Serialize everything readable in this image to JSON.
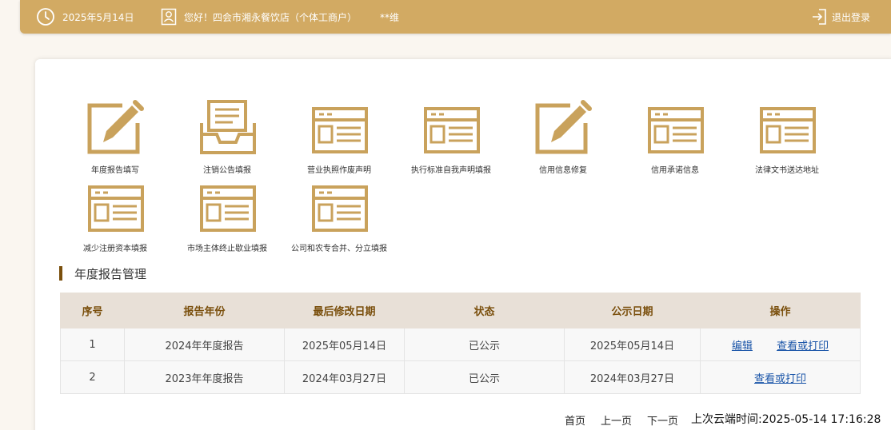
{
  "header": {
    "date": "2025年5月14日",
    "greeting": "您好！四会市湘永餐饮店（个体工商户）",
    "user": "**维",
    "logout_label": "退出登录"
  },
  "colors": {
    "gold": "#d2aa63",
    "icon_gold": "#c9a25c",
    "accent_brown": "#7a4f0c",
    "link_blue": "#1a55a8"
  },
  "tiles": [
    {
      "label": "年度报告填写",
      "icon": "edit-pen-icon"
    },
    {
      "label": "注销公告填报",
      "icon": "inbox-tray-icon"
    },
    {
      "label": "营业执照作废声明",
      "icon": "form-card-icon"
    },
    {
      "label": "执行标准自我声明填报",
      "icon": "form-card-icon"
    },
    {
      "label": "信用信息修复",
      "icon": "edit-pen-icon"
    },
    {
      "label": "信用承诺信息",
      "icon": "form-card-icon"
    },
    {
      "label": "法律文书送达地址",
      "icon": "form-card-icon"
    },
    {
      "label": "减少注册资本填报",
      "icon": "form-card-icon"
    },
    {
      "label": "市场主体终止歇业填报",
      "icon": "form-card-icon"
    },
    {
      "label": "公司和农专合并、分立填报",
      "icon": "form-card-icon"
    }
  ],
  "section": {
    "title": "年度报告管理"
  },
  "table": {
    "headers": [
      "序号",
      "报告年份",
      "最后修改日期",
      "状态",
      "公示日期",
      "操作"
    ],
    "rows": [
      {
        "no": "1",
        "year": "2024年年度报告",
        "modified": "2025年05月14日",
        "status": "已公示",
        "published": "2025年05月14日",
        "actions": [
          "编辑",
          "查看或打印"
        ]
      },
      {
        "no": "2",
        "year": "2023年年度报告",
        "modified": "2024年03月27日",
        "status": "已公示",
        "published": "2024年03月27日",
        "actions": [
          "查看或打印"
        ]
      }
    ]
  },
  "pager": {
    "first": "首页",
    "prev": "上一页",
    "next": "下一页"
  },
  "last_login": "上次云端时间:2025-05-14 17:16:28"
}
